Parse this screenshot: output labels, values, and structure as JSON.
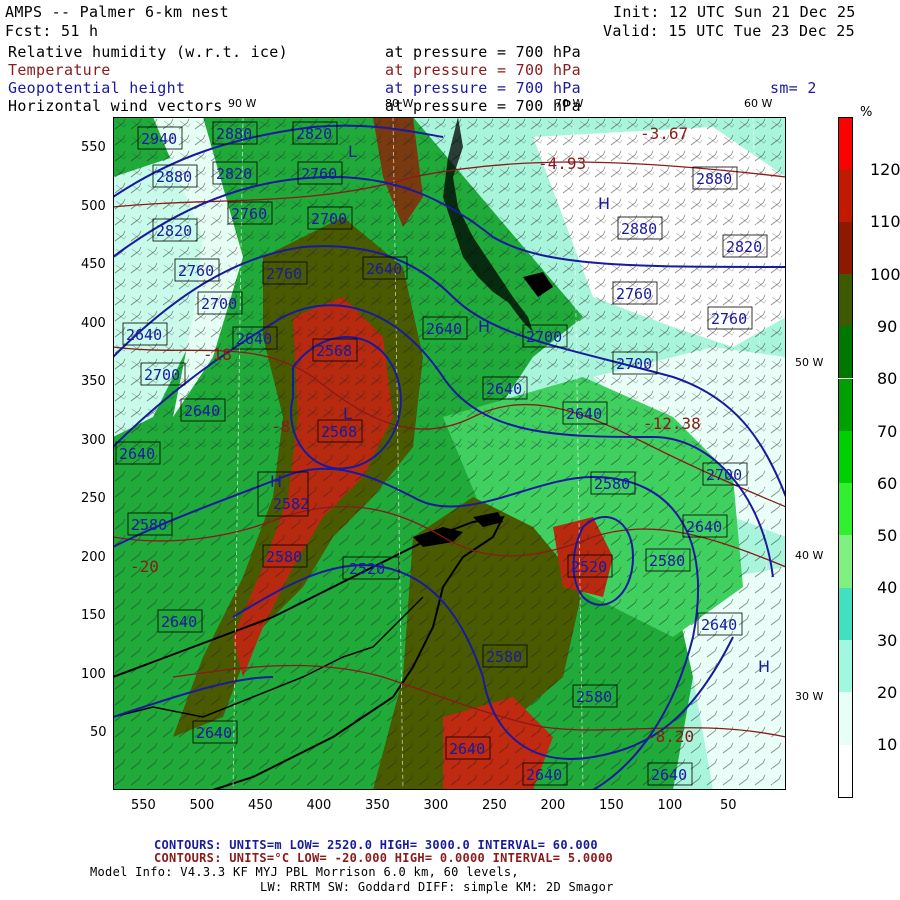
{
  "header": {
    "model": "AMPS -- Palmer 6-km nest",
    "forecast": "Fcst:    51 h",
    "init": "Init: 12 UTC Sun 21 Dec 25",
    "valid": "Valid: 15 UTC Tue 23 Dec 25"
  },
  "fields": [
    {
      "name": "Relative humidity (w.r.t. ice)",
      "level": "at pressure =  700 hPa",
      "color": "#000000"
    },
    {
      "name": "Temperature",
      "level": "at pressure =  700 hPa",
      "color": "#8b1a1a"
    },
    {
      "name": "Geopotential height",
      "level": "at pressure =  700 hPa",
      "color": "#1a1aa0"
    },
    {
      "name": "Horizontal wind vectors",
      "level": "at pressure =  700 hPa",
      "color": "#000000"
    }
  ],
  "smoothing": "sm= 2",
  "x_axis": {
    "ticks": [
      "550",
      "500",
      "450",
      "400",
      "350",
      "300",
      "250",
      "200",
      "150",
      "100",
      "50"
    ]
  },
  "y_axis": {
    "ticks": [
      "550",
      "500",
      "450",
      "400",
      "350",
      "300",
      "250",
      "200",
      "150",
      "100",
      "50"
    ]
  },
  "meridians": {
    "top": [
      "90 W",
      "80 W",
      "70 W",
      "60 W"
    ],
    "right": [
      "50 W",
      "40 W",
      "30 W"
    ]
  },
  "colorbar": {
    "unit": "%",
    "labels": [
      "120",
      "110",
      "100",
      "90",
      "80",
      "70",
      "60",
      "50",
      "40",
      "30",
      "20",
      "10"
    ],
    "colors": [
      "#ff0000",
      "#c01a00",
      "#8b1a00",
      "#3d5a00",
      "#007800",
      "#00a000",
      "#00d000",
      "#30f030",
      "#80f080",
      "#40e0c0",
      "#a0f8e0",
      "#e8fff8",
      "#ffffff"
    ]
  },
  "height_contour_labels": [
    "2940",
    "2880",
    "2820",
    "2760",
    "2700",
    "2640",
    "2580",
    "2520",
    "2568",
    "2582"
  ],
  "temperature_labels": [
    "-3.67",
    "-4.93",
    "-18",
    "-8",
    "-12.38",
    "-8.20",
    "-20"
  ],
  "footer": {
    "height_contours": "CONTOURS:  UNITS=m  LOW=  2520.0      HIGH=  3000.0      INTERVAL=   60.000",
    "temp_contours": "CONTOURS:  UNITS=°C  LOW= -20.000      HIGH=  0.0000      INTERVAL=   5.0000",
    "model_info": "Model Info: V4.3.3    KF       MYJ PBL   Morrison              6.0 km,  60 levels,",
    "physics": "LW: RRTM SW: Goddard DIFF: simple KM: 2D Smagor"
  }
}
